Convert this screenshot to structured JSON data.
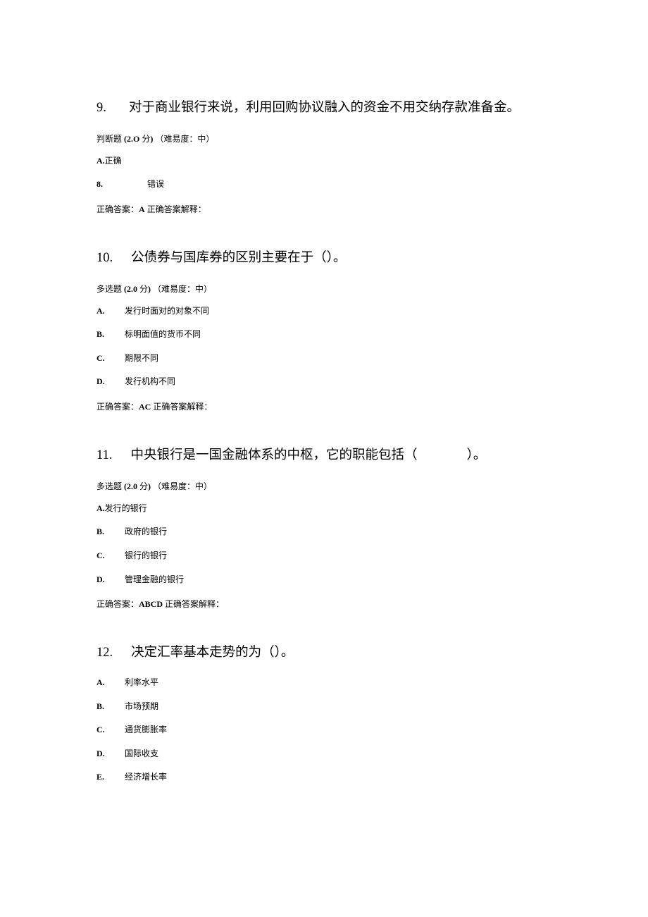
{
  "questions": [
    {
      "number": "9.",
      "title": "对于商业银行来说，利用回购协议融入的资金不用交纳存款准备金。",
      "meta_prefix": "判断题",
      "meta_paren_open": "(",
      "meta_score": "2.O",
      "meta_score_unit": "分",
      "meta_paren_close": ")",
      "meta_diff": "（难易度：中）",
      "options": [
        {
          "label": "A.",
          "text": "正确",
          "style": "nogap"
        },
        {
          "label": "8.",
          "text": "错误",
          "style": "wide"
        }
      ],
      "answer_prefix": "正确答案：",
      "answer_value": "A",
      "answer_suffix": "正确答案解释："
    },
    {
      "number": "10.",
      "title": "公债券与国库券的区别主要在于（）。",
      "meta_prefix": "多选题",
      "meta_paren_open": "(",
      "meta_score": "2.0",
      "meta_score_unit": "分",
      "meta_paren_close": ")",
      "meta_diff": "（难易度：中）",
      "options": [
        {
          "label": "A.",
          "text": "发行时面对的对象不同",
          "style": ""
        },
        {
          "label": "B.",
          "text": "标明面值的货币不同",
          "style": ""
        },
        {
          "label": "C.",
          "text": "期限不同",
          "style": ""
        },
        {
          "label": "D.",
          "text": "发行机构不同",
          "style": ""
        }
      ],
      "answer_prefix": "正确答案：",
      "answer_value": "AC",
      "answer_suffix": "正确答案解释："
    },
    {
      "number": "11.",
      "title_pre": "中央银行是一国金融体系的中枢，它的职能包括（",
      "title_post": "）。",
      "meta_prefix": "多选题",
      "meta_paren_open": "(",
      "meta_score": "2.0",
      "meta_score_unit": "分",
      "meta_paren_close": ")",
      "meta_diff": "（难易度：中）",
      "options": [
        {
          "label": "A.",
          "text": "发行的银行",
          "style": "nogap"
        },
        {
          "label": "B.",
          "text": "政府的银行",
          "style": ""
        },
        {
          "label": "C.",
          "text": "银行的银行",
          "style": ""
        },
        {
          "label": "D.",
          "text": "管理金融的银行",
          "style": ""
        }
      ],
      "answer_prefix": "正确答案：",
      "answer_value": "ABCD",
      "answer_suffix": "正确答案解释："
    },
    {
      "number": "12.",
      "title": "决定汇率基本走势的为（）。",
      "options": [
        {
          "label": "A.",
          "text": "利率水平",
          "style": ""
        },
        {
          "label": "B.",
          "text": "市场预期",
          "style": ""
        },
        {
          "label": "C.",
          "text": "通货膨胀率",
          "style": ""
        },
        {
          "label": "D.",
          "text": "国际收支",
          "style": ""
        },
        {
          "label": "E.",
          "text": "经济增长率",
          "style": ""
        }
      ]
    }
  ]
}
